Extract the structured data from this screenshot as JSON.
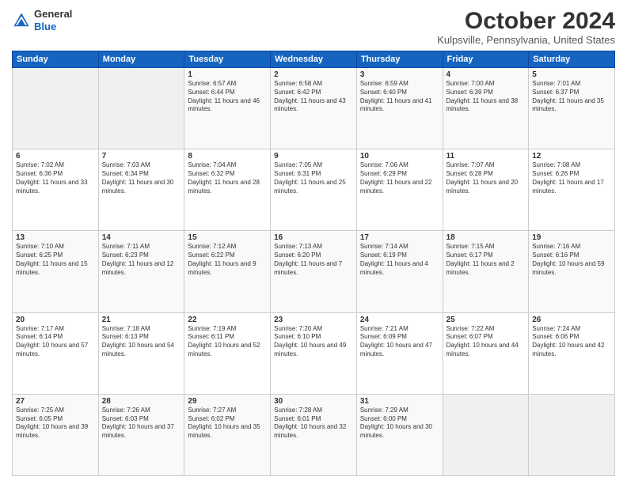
{
  "header": {
    "logo_general": "General",
    "logo_blue": "Blue",
    "month_title": "October 2024",
    "location": "Kulpsville, Pennsylvania, United States"
  },
  "days_of_week": [
    "Sunday",
    "Monday",
    "Tuesday",
    "Wednesday",
    "Thursday",
    "Friday",
    "Saturday"
  ],
  "weeks": [
    [
      {
        "day": "",
        "empty": true
      },
      {
        "day": "",
        "empty": true
      },
      {
        "day": "1",
        "sunrise": "Sunrise: 6:57 AM",
        "sunset": "Sunset: 6:44 PM",
        "daylight": "Daylight: 11 hours and 46 minutes."
      },
      {
        "day": "2",
        "sunrise": "Sunrise: 6:58 AM",
        "sunset": "Sunset: 6:42 PM",
        "daylight": "Daylight: 11 hours and 43 minutes."
      },
      {
        "day": "3",
        "sunrise": "Sunrise: 6:59 AM",
        "sunset": "Sunset: 6:40 PM",
        "daylight": "Daylight: 11 hours and 41 minutes."
      },
      {
        "day": "4",
        "sunrise": "Sunrise: 7:00 AM",
        "sunset": "Sunset: 6:39 PM",
        "daylight": "Daylight: 11 hours and 38 minutes."
      },
      {
        "day": "5",
        "sunrise": "Sunrise: 7:01 AM",
        "sunset": "Sunset: 6:37 PM",
        "daylight": "Daylight: 11 hours and 35 minutes."
      }
    ],
    [
      {
        "day": "6",
        "sunrise": "Sunrise: 7:02 AM",
        "sunset": "Sunset: 6:36 PM",
        "daylight": "Daylight: 11 hours and 33 minutes."
      },
      {
        "day": "7",
        "sunrise": "Sunrise: 7:03 AM",
        "sunset": "Sunset: 6:34 PM",
        "daylight": "Daylight: 11 hours and 30 minutes."
      },
      {
        "day": "8",
        "sunrise": "Sunrise: 7:04 AM",
        "sunset": "Sunset: 6:32 PM",
        "daylight": "Daylight: 11 hours and 28 minutes."
      },
      {
        "day": "9",
        "sunrise": "Sunrise: 7:05 AM",
        "sunset": "Sunset: 6:31 PM",
        "daylight": "Daylight: 11 hours and 25 minutes."
      },
      {
        "day": "10",
        "sunrise": "Sunrise: 7:06 AM",
        "sunset": "Sunset: 6:29 PM",
        "daylight": "Daylight: 11 hours and 22 minutes."
      },
      {
        "day": "11",
        "sunrise": "Sunrise: 7:07 AM",
        "sunset": "Sunset: 6:28 PM",
        "daylight": "Daylight: 11 hours and 20 minutes."
      },
      {
        "day": "12",
        "sunrise": "Sunrise: 7:08 AM",
        "sunset": "Sunset: 6:26 PM",
        "daylight": "Daylight: 11 hours and 17 minutes."
      }
    ],
    [
      {
        "day": "13",
        "sunrise": "Sunrise: 7:10 AM",
        "sunset": "Sunset: 6:25 PM",
        "daylight": "Daylight: 11 hours and 15 minutes."
      },
      {
        "day": "14",
        "sunrise": "Sunrise: 7:11 AM",
        "sunset": "Sunset: 6:23 PM",
        "daylight": "Daylight: 11 hours and 12 minutes."
      },
      {
        "day": "15",
        "sunrise": "Sunrise: 7:12 AM",
        "sunset": "Sunset: 6:22 PM",
        "daylight": "Daylight: 11 hours and 9 minutes."
      },
      {
        "day": "16",
        "sunrise": "Sunrise: 7:13 AM",
        "sunset": "Sunset: 6:20 PM",
        "daylight": "Daylight: 11 hours and 7 minutes."
      },
      {
        "day": "17",
        "sunrise": "Sunrise: 7:14 AM",
        "sunset": "Sunset: 6:19 PM",
        "daylight": "Daylight: 11 hours and 4 minutes."
      },
      {
        "day": "18",
        "sunrise": "Sunrise: 7:15 AM",
        "sunset": "Sunset: 6:17 PM",
        "daylight": "Daylight: 11 hours and 2 minutes."
      },
      {
        "day": "19",
        "sunrise": "Sunrise: 7:16 AM",
        "sunset": "Sunset: 6:16 PM",
        "daylight": "Daylight: 10 hours and 59 minutes."
      }
    ],
    [
      {
        "day": "20",
        "sunrise": "Sunrise: 7:17 AM",
        "sunset": "Sunset: 6:14 PM",
        "daylight": "Daylight: 10 hours and 57 minutes."
      },
      {
        "day": "21",
        "sunrise": "Sunrise: 7:18 AM",
        "sunset": "Sunset: 6:13 PM",
        "daylight": "Daylight: 10 hours and 54 minutes."
      },
      {
        "day": "22",
        "sunrise": "Sunrise: 7:19 AM",
        "sunset": "Sunset: 6:11 PM",
        "daylight": "Daylight: 10 hours and 52 minutes."
      },
      {
        "day": "23",
        "sunrise": "Sunrise: 7:20 AM",
        "sunset": "Sunset: 6:10 PM",
        "daylight": "Daylight: 10 hours and 49 minutes."
      },
      {
        "day": "24",
        "sunrise": "Sunrise: 7:21 AM",
        "sunset": "Sunset: 6:09 PM",
        "daylight": "Daylight: 10 hours and 47 minutes."
      },
      {
        "day": "25",
        "sunrise": "Sunrise: 7:22 AM",
        "sunset": "Sunset: 6:07 PM",
        "daylight": "Daylight: 10 hours and 44 minutes."
      },
      {
        "day": "26",
        "sunrise": "Sunrise: 7:24 AM",
        "sunset": "Sunset: 6:06 PM",
        "daylight": "Daylight: 10 hours and 42 minutes."
      }
    ],
    [
      {
        "day": "27",
        "sunrise": "Sunrise: 7:25 AM",
        "sunset": "Sunset: 6:05 PM",
        "daylight": "Daylight: 10 hours and 39 minutes."
      },
      {
        "day": "28",
        "sunrise": "Sunrise: 7:26 AM",
        "sunset": "Sunset: 6:03 PM",
        "daylight": "Daylight: 10 hours and 37 minutes."
      },
      {
        "day": "29",
        "sunrise": "Sunrise: 7:27 AM",
        "sunset": "Sunset: 6:02 PM",
        "daylight": "Daylight: 10 hours and 35 minutes."
      },
      {
        "day": "30",
        "sunrise": "Sunrise: 7:28 AM",
        "sunset": "Sunset: 6:01 PM",
        "daylight": "Daylight: 10 hours and 32 minutes."
      },
      {
        "day": "31",
        "sunrise": "Sunrise: 7:29 AM",
        "sunset": "Sunset: 6:00 PM",
        "daylight": "Daylight: 10 hours and 30 minutes."
      },
      {
        "day": "",
        "empty": true
      },
      {
        "day": "",
        "empty": true
      }
    ]
  ]
}
